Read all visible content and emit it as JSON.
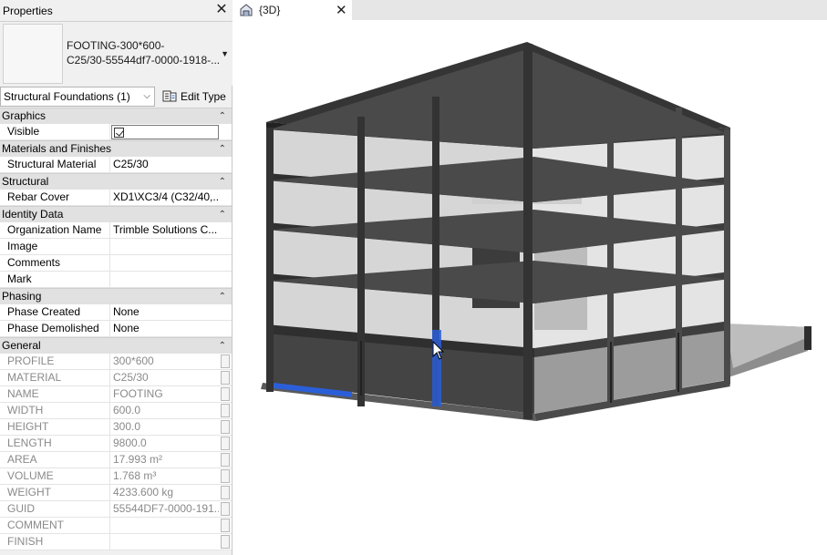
{
  "properties": {
    "title": "Properties",
    "type_name_line1": "FOOTING-300*600-",
    "type_name_line2": "C25/30-55544df7-0000-1918-...",
    "instance_filter": "Structural Foundations (1)",
    "edit_type_label": "Edit Type",
    "groups": [
      {
        "name": "Graphics",
        "rows": [
          {
            "key": "Visible",
            "value": "",
            "checkbox": true,
            "checked": true
          }
        ]
      },
      {
        "name": "Materials and Finishes",
        "rows": [
          {
            "key": "Structural Material",
            "value": "C25/30"
          }
        ]
      },
      {
        "name": "Structural",
        "rows": [
          {
            "key": "Rebar Cover",
            "value": "XD1\\XC3/4 (C32/40,..."
          }
        ]
      },
      {
        "name": "Identity Data",
        "rows": [
          {
            "key": "Organization Name",
            "value": "Trimble Solutions C..."
          },
          {
            "key": "Image",
            "value": ""
          },
          {
            "key": "Comments",
            "value": ""
          },
          {
            "key": "Mark",
            "value": ""
          }
        ]
      },
      {
        "name": "Phasing",
        "rows": [
          {
            "key": "Phase Created",
            "value": "None"
          },
          {
            "key": "Phase Demolished",
            "value": "None"
          }
        ]
      },
      {
        "name": "General",
        "readonly": true,
        "rows": [
          {
            "key": "PROFILE",
            "value": "300*600"
          },
          {
            "key": "MATERIAL",
            "value": "C25/30"
          },
          {
            "key": "NAME",
            "value": "FOOTING"
          },
          {
            "key": "WIDTH",
            "value": "600.0"
          },
          {
            "key": "HEIGHT",
            "value": "300.0"
          },
          {
            "key": "LENGTH",
            "value": "9800.0"
          },
          {
            "key": "AREA",
            "value": "17.993 m²"
          },
          {
            "key": "VOLUME",
            "value": "1.768 m³"
          },
          {
            "key": "WEIGHT",
            "value": "4233.600 kg"
          },
          {
            "key": "GUID",
            "value": "55544DF7-0000-191..."
          },
          {
            "key": "COMMENT",
            "value": ""
          },
          {
            "key": "FINISH",
            "value": ""
          }
        ]
      }
    ]
  },
  "view": {
    "tab_label": "{3D}",
    "colors": {
      "structure": "#3a3a3a",
      "walls_light": "#9a9a9a",
      "selection": "#2b5fd9"
    }
  }
}
